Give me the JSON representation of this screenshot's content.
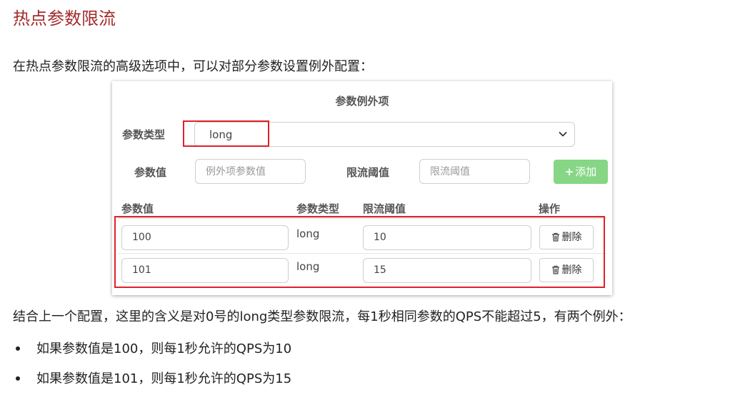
{
  "heading": "热点参数限流",
  "intro": "在热点参数限流的高级选项中，可以对部分参数设置例外配置：",
  "panel": {
    "title": "参数例外项",
    "param_type_label": "参数类型",
    "param_type_value": "long",
    "param_value_label": "参数值",
    "param_value_placeholder": "例外项参数值",
    "threshold_label": "限流阈值",
    "threshold_placeholder": "限流阈值",
    "add_label": "添加",
    "columns": [
      "参数值",
      "参数类型",
      "限流阈值",
      "操作"
    ],
    "rows": [
      {
        "value": "100",
        "type": "long",
        "threshold": "10",
        "action": "删除"
      },
      {
        "value": "101",
        "type": "long",
        "threshold": "15",
        "action": "删除"
      }
    ],
    "highlight_color": "#e0202a",
    "add_button_color": "#86d686"
  },
  "summary": "结合上一个配置，这里的含义是对0号的long类型参数限流，每1秒相同参数的QPS不能超过5，有两个例外：",
  "bullets": [
    "如果参数值是100，则每1秒允许的QPS为10",
    "如果参数值是101，则每1秒允许的QPS为15"
  ],
  "colors": {
    "heading": "#a42b2b",
    "text": "#222222"
  }
}
